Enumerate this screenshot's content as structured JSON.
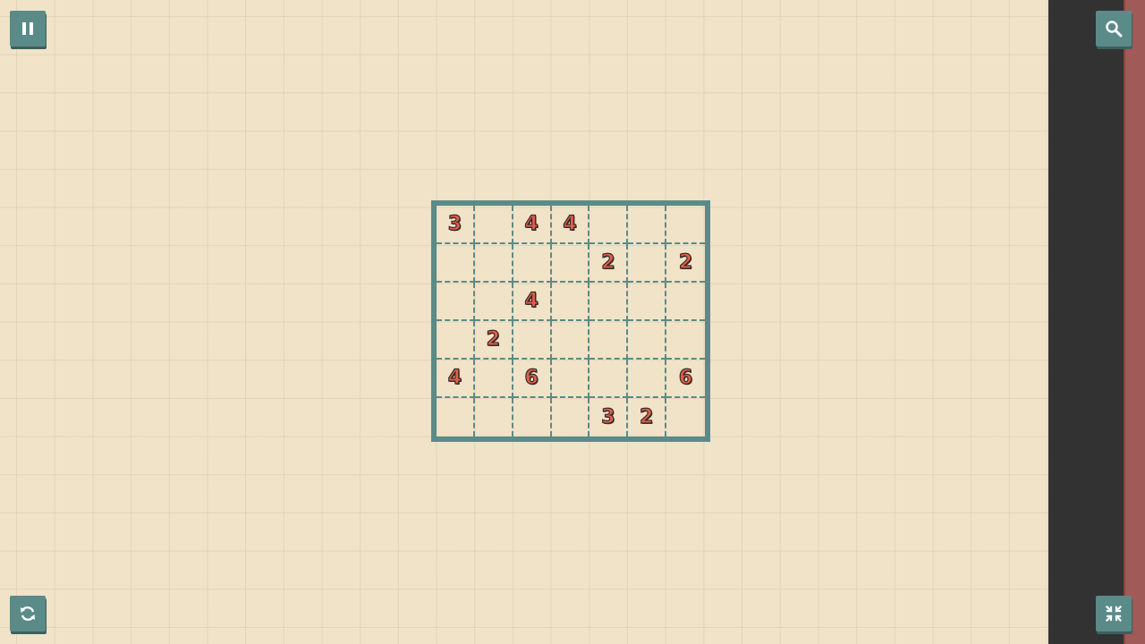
{
  "icons": {
    "pause": "pause-icon",
    "search": "magnifier-icon",
    "reset": "refresh-icon",
    "fullscreen": "collapse-icon"
  },
  "colors": {
    "background": "#f0e3c8",
    "accent": "#5b8b88",
    "clue": "#e0604a",
    "side_panel": "#323232",
    "side_stripe": "#a05a58"
  },
  "puzzle": {
    "columns": 7,
    "rows": 6,
    "cells": [
      [
        "3",
        "",
        "4",
        "4",
        "",
        "",
        ""
      ],
      [
        "",
        "",
        "",
        "",
        "2",
        "",
        "2"
      ],
      [
        "",
        "",
        "4",
        "",
        "",
        "",
        ""
      ],
      [
        "",
        "2",
        "",
        "",
        "",
        "",
        ""
      ],
      [
        "4",
        "",
        "6",
        "",
        "",
        "",
        "6"
      ],
      [
        "",
        "",
        "",
        "",
        "3",
        "2",
        ""
      ]
    ]
  }
}
